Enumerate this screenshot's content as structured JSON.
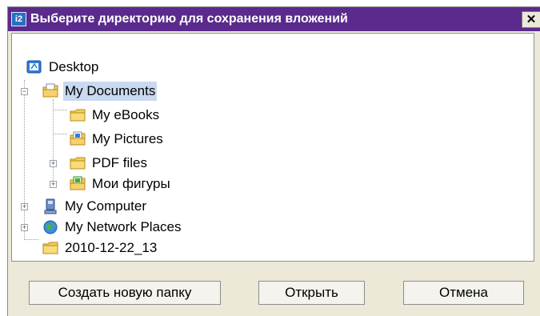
{
  "dialog": {
    "title": "Выберите директорию для сохранения вложений",
    "close_glyph": "✕",
    "app_icon_glyph": "i2"
  },
  "tree": {
    "desktop": "Desktop",
    "my_documents": "My Documents",
    "my_ebooks": "My eBooks",
    "my_pictures": "My Pictures",
    "pdf_files": "PDF files",
    "moi_figury": "Мои фигуры",
    "my_computer": "My Computer",
    "my_network_places": "My Network Places",
    "folder_2010": "2010-12-22_13",
    "expander_glyph": "+",
    "collapse_glyph": "−"
  },
  "buttons": {
    "new_folder": "Создать новую папку",
    "open": "Открыть",
    "cancel": "Отмена"
  },
  "colors": {
    "titlebar": "#5a2a8c",
    "selection": "#c9d9ef",
    "folder": "#f3cf55"
  }
}
